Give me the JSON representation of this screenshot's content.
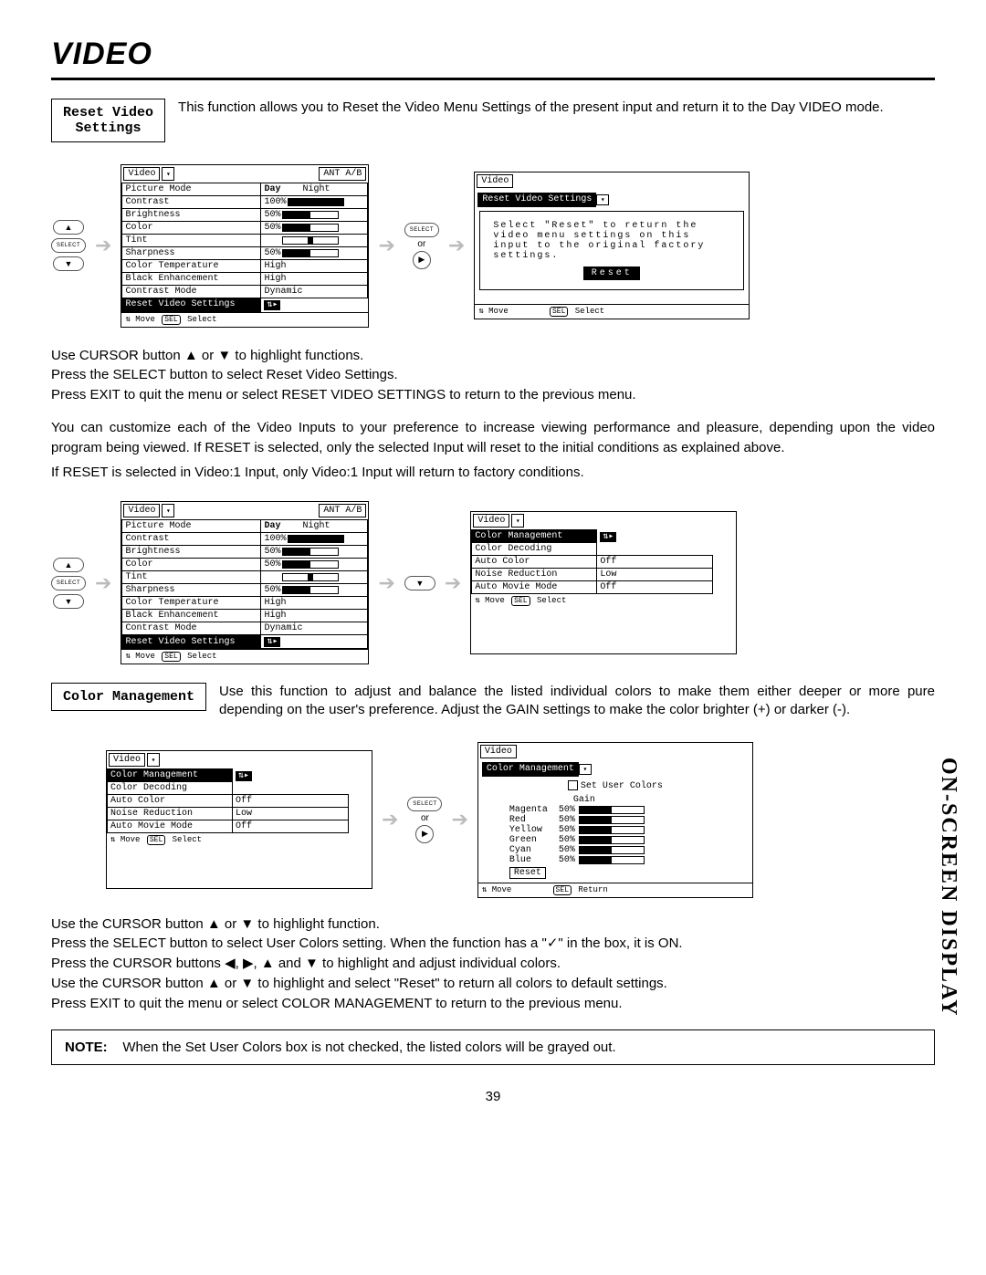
{
  "page_title": "VIDEO",
  "section_label": "ON-SCREEN DISPLAY",
  "page_number": "39",
  "reset_video": {
    "label": "Reset Video\nSettings",
    "desc": "This function allows you to Reset the Video Menu Settings of the present input and return it to the Day VIDEO mode.",
    "instr1": "Use CURSOR button ▲ or ▼ to highlight functions.",
    "instr2": "Press the SELECT button to select Reset Video Settings.",
    "instr3": "Press EXIT to quit the menu or select RESET VIDEO SETTINGS to return to the previous menu.",
    "para1": "You can customize each of the Video Inputs to your preference to increase viewing performance and pleasure, depending upon the video program being viewed. If RESET is selected, only the selected Input will reset to the initial conditions as explained above.",
    "para2": "If RESET is selected in Video:1 Input, only Video:1 Input will return to factory conditions."
  },
  "color_mgmt": {
    "label": "Color Management",
    "desc": "Use this function to adjust and balance the listed individual colors to make them either deeper or more pure depending on the user's preference. Adjust the GAIN settings to make the color brighter (+) or darker (-).",
    "instr1": "Use the CURSOR button ▲ or ▼ to highlight function.",
    "instr2": "Press the SELECT button to select User Colors setting.  When the function has a \"✓\" in the box, it is ON.",
    "instr3": "Press  the CURSOR buttons ◀, ▶, ▲ and ▼ to highlight and adjust individual colors.",
    "instr4": "Use  the CURSOR button ▲ or ▼ to highlight and select \"Reset\" to return all colors to default settings.",
    "instr5": "Press EXIT to quit the menu or select COLOR MANAGEMENT to return to the previous menu."
  },
  "note": {
    "label": "NOTE:",
    "text": "When the Set User Colors box is not checked, the listed colors will be grayed out."
  },
  "osd_video": {
    "title": "Video",
    "source": "ANT A/B",
    "day": "Day",
    "night": "Night",
    "rows": [
      {
        "k": "Picture Mode"
      },
      {
        "k": "Contrast",
        "v": "100%",
        "fill": 100
      },
      {
        "k": "Brightness",
        "v": "50%",
        "fill": 50
      },
      {
        "k": "Color",
        "v": "50%",
        "fill": 50
      },
      {
        "k": "Tint",
        "v": "",
        "mid": true
      },
      {
        "k": "Sharpness",
        "v": "50%",
        "fill": 50
      },
      {
        "k": "Color Temperature",
        "v": "High"
      },
      {
        "k": "Black Enhancement",
        "v": "High"
      },
      {
        "k": "Contrast Mode",
        "v": "Dynamic"
      }
    ],
    "reset_row": "Reset Video Settings",
    "foot_move": "Move",
    "foot_sel": "Select"
  },
  "osd_reset_dlg": {
    "title": "Video",
    "subtitle": "Reset Video Settings",
    "msg": "Select \"Reset\" to return the video menu settings on this input to the original factory settings.",
    "btn": "Reset",
    "foot_move": "Move",
    "foot_sel": "Select"
  },
  "osd_cm_list": {
    "title": "Video",
    "rows": [
      {
        "k": "Color Management",
        "sel": true,
        "icon": true
      },
      {
        "k": "Color Decoding"
      },
      {
        "k": "Auto Color",
        "v": "Off"
      },
      {
        "k": "Noise Reduction",
        "v": "Low"
      },
      {
        "k": "Auto Movie Mode",
        "v": "Off"
      }
    ],
    "foot_move": "Move",
    "foot_sel": "Select"
  },
  "osd_cm_gain": {
    "title": "Video",
    "subtitle": "Color Management",
    "setuser": "Set User Colors",
    "gain": "Gain",
    "colors": [
      "Magenta",
      "Red",
      "Yellow",
      "Green",
      "Cyan",
      "Blue"
    ],
    "pct": "50%",
    "reset": "Reset",
    "foot_move": "Move",
    "foot_ret": "Return"
  },
  "connector": {
    "select": "SELECT",
    "or": "or"
  }
}
